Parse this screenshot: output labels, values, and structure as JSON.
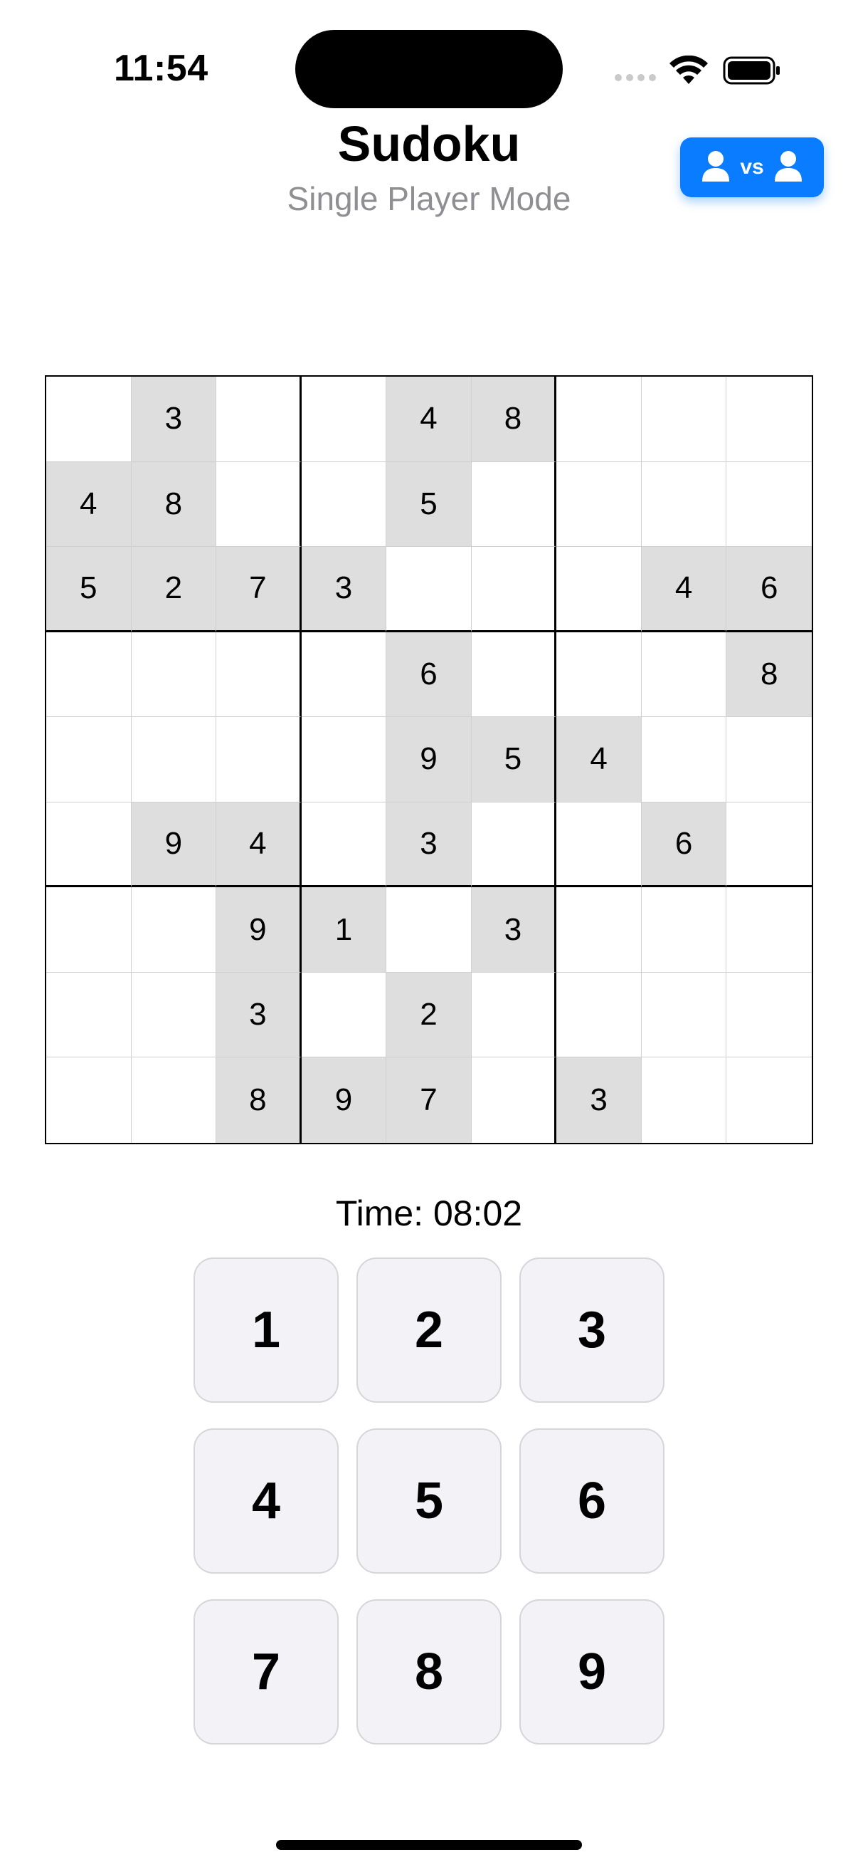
{
  "status_bar": {
    "time": "11:54"
  },
  "header": {
    "title": "Sudoku",
    "subtitle": "Single Player Mode",
    "vs_button_label": "vs",
    "vs_button_color": "#0a7cff"
  },
  "board": {
    "given_color": "#dedede",
    "rows": [
      [
        "",
        "3",
        "",
        "",
        "4",
        "8",
        "",
        "",
        ""
      ],
      [
        "4",
        "8",
        "",
        "",
        "5",
        "",
        "",
        "",
        ""
      ],
      [
        "5",
        "2",
        "7",
        "3",
        "",
        "",
        "",
        "4",
        "6"
      ],
      [
        "",
        "",
        "",
        "",
        "6",
        "",
        "",
        "",
        "8"
      ],
      [
        "",
        "",
        "",
        "",
        "9",
        "5",
        "4",
        "",
        ""
      ],
      [
        "",
        "9",
        "4",
        "",
        "3",
        "",
        "",
        "6",
        ""
      ],
      [
        "",
        "",
        "9",
        "1",
        "",
        "3",
        "",
        "",
        ""
      ],
      [
        "",
        "",
        "3",
        "",
        "2",
        "",
        "",
        "",
        ""
      ],
      [
        "",
        "",
        "8",
        "9",
        "7",
        "",
        "3",
        "",
        ""
      ]
    ],
    "given_cells": [
      [
        1,
        4,
        5
      ],
      [
        0,
        1,
        4
      ],
      [
        0,
        1,
        2,
        3,
        7,
        8
      ],
      [
        4,
        8
      ],
      [
        4,
        5,
        6
      ],
      [
        1,
        2,
        4,
        7
      ],
      [
        2,
        3,
        5
      ],
      [
        2,
        4
      ],
      [
        2,
        3,
        4,
        6
      ]
    ]
  },
  "timer": {
    "label": "Time: 08:02"
  },
  "numpad": {
    "keys": [
      "1",
      "2",
      "3",
      "4",
      "5",
      "6",
      "7",
      "8",
      "9"
    ]
  }
}
